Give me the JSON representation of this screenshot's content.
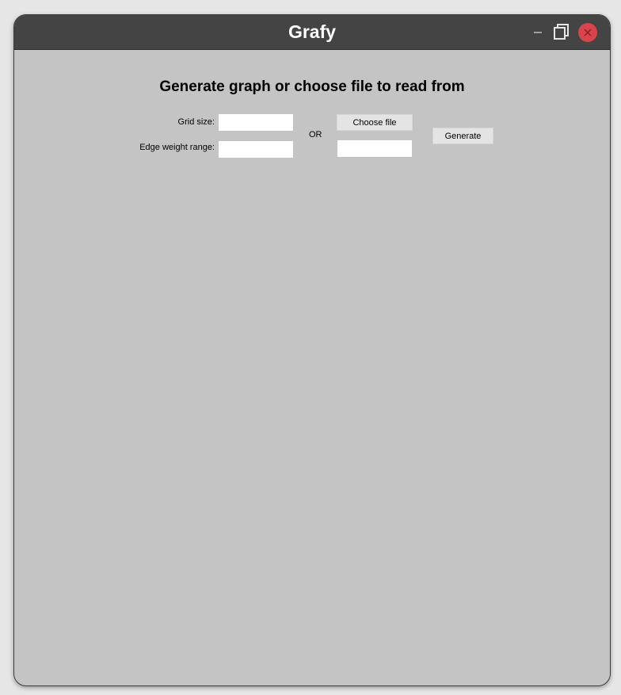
{
  "window": {
    "title": "Grafy",
    "controls": {
      "minimize_icon": "minimize-icon",
      "maximize_icon": "restore-icon",
      "close_icon": "close-icon",
      "close_color": "#d9434c"
    },
    "titlebar_color": "#444444",
    "background_color": "#c4c4c4"
  },
  "main": {
    "heading": "Generate graph or choose file to read from",
    "grid_size": {
      "label": "Grid size:",
      "value": ""
    },
    "edge_weight_range": {
      "label": "Edge weight range:",
      "value": ""
    },
    "separator": "OR",
    "choose_file_label": "Choose file",
    "file_path_value": "",
    "generate_label": "Generate"
  }
}
